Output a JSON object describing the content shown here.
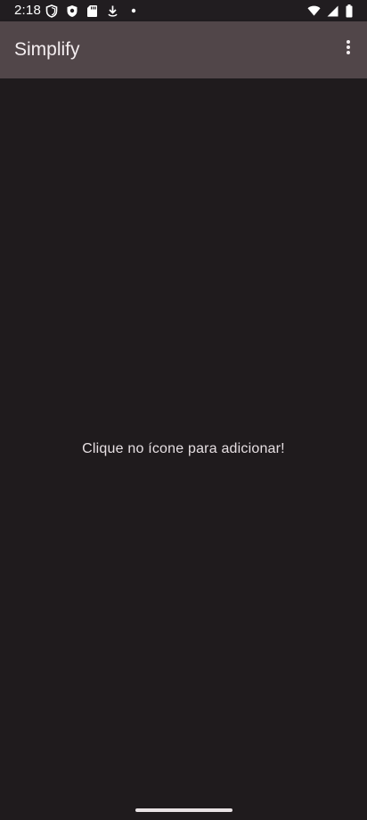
{
  "status_bar": {
    "time": "2:18",
    "left_icons": [
      "shield-outline-icon",
      "shield-filled-icon",
      "sd-card-icon",
      "download-icon",
      "dot-icon"
    ],
    "right_icons": [
      "wifi-icon",
      "cellular-signal-icon",
      "battery-icon"
    ]
  },
  "app_bar": {
    "title": "Simplify",
    "menu_icon": "more-vert-icon"
  },
  "content": {
    "empty_message": "Clique no ícone para adicionar!"
  },
  "colors": {
    "background": "#1f1b1d",
    "app_bar": "#514649",
    "text": "#e8e2e4"
  }
}
